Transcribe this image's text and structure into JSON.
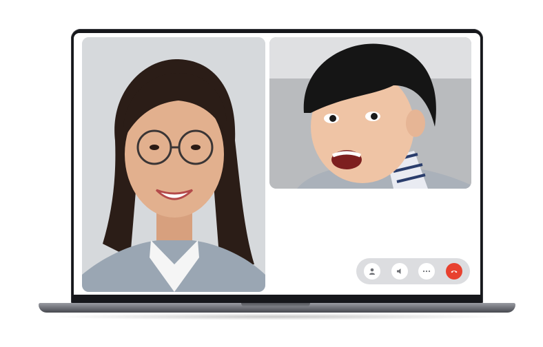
{
  "call": {
    "participants": [
      {
        "role": "caller-video",
        "description_icon": "person-video"
      },
      {
        "role": "callee-video",
        "description_icon": "person-video"
      }
    ],
    "controls": [
      {
        "name": "profile",
        "icon": "person-icon"
      },
      {
        "name": "speaker",
        "icon": "speaker-icon"
      },
      {
        "name": "more",
        "icon": "more-icon"
      },
      {
        "name": "end-call",
        "icon": "hang-up-icon"
      }
    ]
  },
  "colors": {
    "end_call": "#e8412f",
    "control_bar": "#dcdde0",
    "laptop_bezel": "#16171b"
  }
}
